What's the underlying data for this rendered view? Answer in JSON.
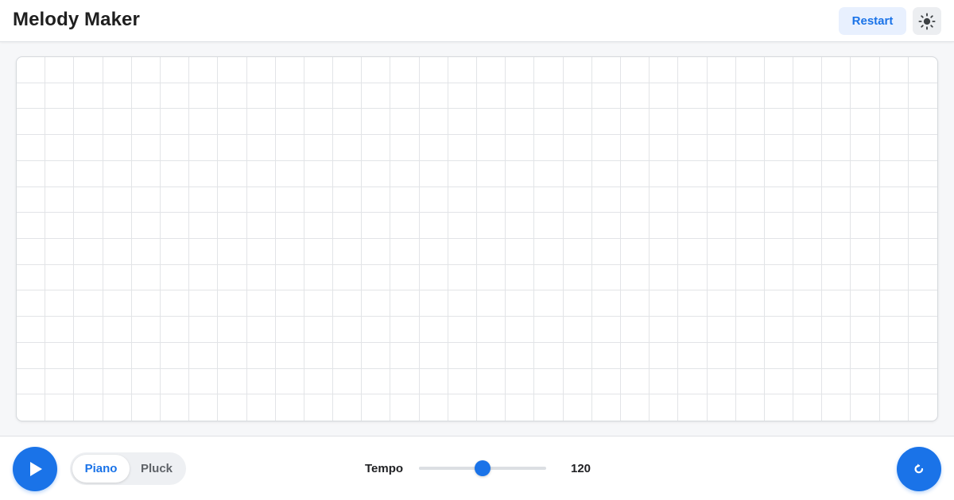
{
  "app": {
    "title": "Melody Maker"
  },
  "header": {
    "restart_label": "Restart",
    "theme_icon": "sun-icon"
  },
  "sequencer": {
    "columns": 32,
    "rows": 14,
    "active_cells": []
  },
  "controls": {
    "play_icon": "play-icon",
    "instruments": [
      {
        "label": "Piano",
        "selected": true
      },
      {
        "label": "Pluck",
        "selected": false
      }
    ],
    "tempo": {
      "label": "Tempo",
      "value": "120",
      "fraction": 0.5
    },
    "loop_icon": "loop-icon"
  },
  "colors": {
    "accent": "#1a73e8",
    "accent_light": "#e8f0fe",
    "grid_line": "#e2e4e7"
  }
}
